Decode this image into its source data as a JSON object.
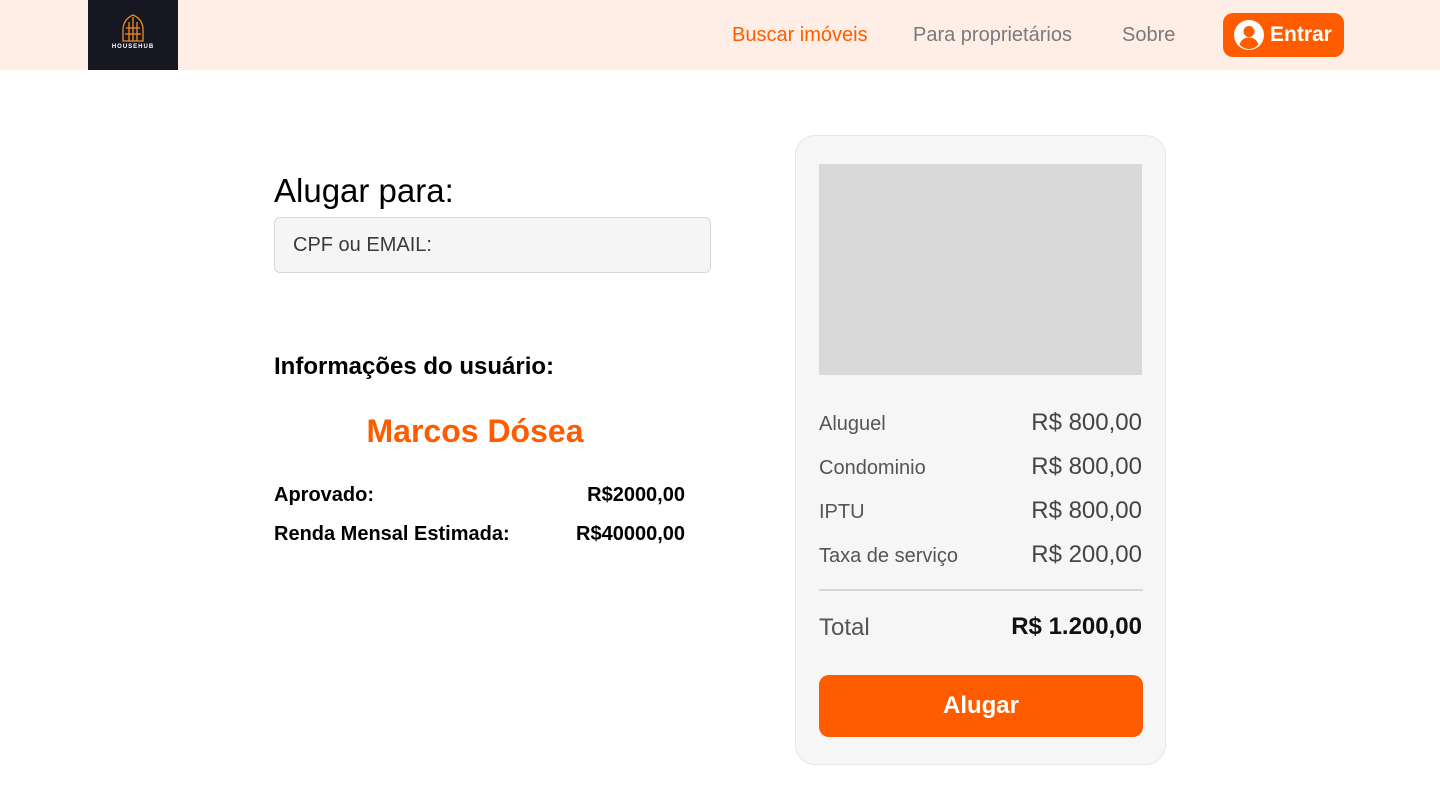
{
  "brand": {
    "name": "HOUSEHUB"
  },
  "nav": {
    "links": [
      "Buscar imóveis",
      "Para proprietários",
      "Sobre"
    ],
    "login_label": "Entrar"
  },
  "rent_form": {
    "heading": "Alugar para:",
    "input_placeholder": "CPF ou EMAIL:",
    "input_value": ""
  },
  "user_info": {
    "heading": "Informações do usuário:",
    "name": "Marcos Dósea",
    "approved_label": "Aprovado:",
    "approved_value": "R$2000,00",
    "income_label": "Renda Mensal Estimada:",
    "income_value": "R$40000,00"
  },
  "summary": {
    "items": [
      {
        "label": "Aluguel",
        "value": "R$ 800,00"
      },
      {
        "label": "Condominio",
        "value": "R$ 800,00"
      },
      {
        "label": "IPTU",
        "value": "R$ 800,00"
      },
      {
        "label": "Taxa de serviço",
        "value": "R$ 200,00"
      }
    ],
    "total_label": "Total",
    "total_value": "R$ 1.200,00",
    "button_label": "Alugar"
  },
  "colors": {
    "accent": "#ff5c00",
    "header_bg": "#ffeee6",
    "logo_bg": "#171723",
    "card_bg": "#f6f6f6",
    "image_placeholder": "#d9d9d9"
  }
}
